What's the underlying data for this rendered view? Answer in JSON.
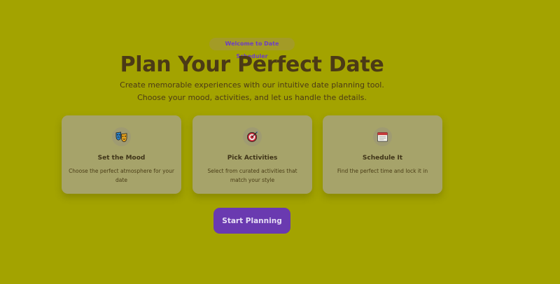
{
  "hero": {
    "badge": "Welcome to Date Scheduler",
    "title": "Plan Your Perfect Date",
    "subtitle": "Create memorable experiences with our intuitive date planning tool. Choose your mood, activities, and let us handle the details."
  },
  "features": [
    {
      "icon": "theater-masks-icon",
      "title": "Set the Mood",
      "description": "Choose the perfect atmosphere for your date"
    },
    {
      "icon": "target-icon",
      "title": "Pick Activities",
      "description": "Select from curated activities that match your style"
    },
    {
      "icon": "calendar-icon",
      "title": "Schedule It",
      "description": "Find the perfect time and lock it in"
    }
  ],
  "cta": {
    "label": "Start Planning"
  },
  "colors": {
    "background": "#a3a300",
    "card": "#a6a36a",
    "accent": "#6a3ab0",
    "heading": "#4b3a16"
  }
}
